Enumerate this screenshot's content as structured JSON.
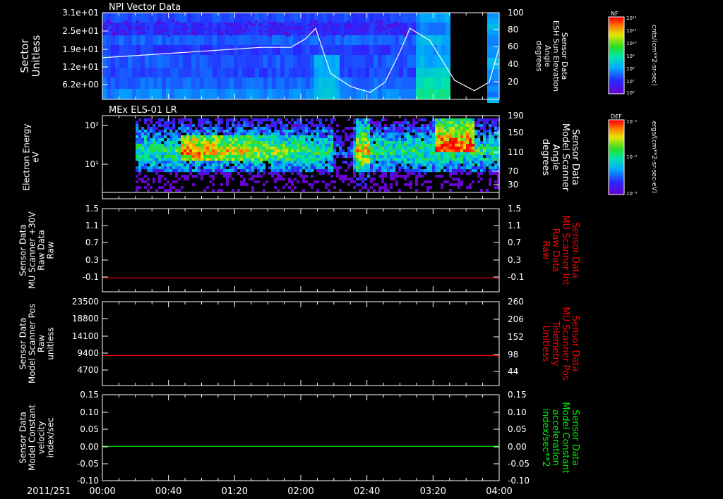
{
  "date_label": "2011/251",
  "time_ticks": [
    "00:00",
    "00:40",
    "01:20",
    "02:00",
    "02:40",
    "03:20",
    "04:00"
  ],
  "colors": {
    "red": "#ff0000",
    "green": "#00ee00",
    "white": "#ffffff"
  },
  "chart_data": [
    {
      "type": "heatmap",
      "title": "NPI Vector Data",
      "left_axis": {
        "label_lines": [
          "Sector",
          "Unitless"
        ],
        "ticks": [
          "3.1e+01",
          "2.5e+01",
          "1.9e+01",
          "1.2e+01",
          "6.2e+00"
        ]
      },
      "right_axis": {
        "label_lines": [
          "Sensor Data",
          "ESH Sun Elevation",
          "Angle",
          "degrees"
        ],
        "range": [
          0,
          100
        ],
        "ticks": [
          "100",
          "80",
          "60",
          "40",
          "20"
        ]
      },
      "colorbar": {
        "label": "NF",
        "unit": "cnts/(cm**2-sr-sec)",
        "ticks": [
          "10¹²",
          "10¹¹",
          "10¹⁰",
          "10⁹",
          "10⁸",
          "10⁷",
          "10⁶"
        ]
      },
      "overlay_line": {
        "x_hours": [
          0,
          1.6,
          1.9,
          2.05,
          2.15,
          2.3,
          2.5,
          2.7,
          2.85,
          3.0,
          3.1,
          3.3,
          3.55,
          3.75,
          3.9,
          4.0
        ],
        "y": [
          48,
          60,
          60,
          70,
          82,
          30,
          15,
          8,
          20,
          55,
          82,
          68,
          22,
          10,
          20,
          60
        ]
      }
    },
    {
      "type": "heatmap",
      "title": "MEx ELS-01 LR",
      "left_axis": {
        "label_lines": [
          "Electron Energy",
          "eV"
        ],
        "scale": "log",
        "ticks": [
          "10²",
          "10¹"
        ]
      },
      "right_axis": {
        "label_lines": [
          "Sensor Data",
          "Model Scanner",
          "Angle",
          "degrees"
        ],
        "range": [
          10,
          190
        ],
        "ticks": [
          "190",
          "150",
          "110",
          "70",
          "30"
        ]
      },
      "colorbar": {
        "label": "DEF",
        "unit": "ergs/(cm**2-sr-sec-eV)",
        "ticks": [
          "10⁻¹",
          "10⁻²",
          "10⁻³"
        ]
      },
      "overlay_line": {
        "x_hours": [
          0,
          4.0
        ],
        "y": [
          10,
          10
        ]
      }
    },
    {
      "type": "line",
      "left_axis": {
        "label_lines": [
          "Sensor Data",
          "MU Scanner +30V",
          "Raw Data",
          "Raw"
        ],
        "ticks": [
          "1.5",
          "1.1",
          "0.7",
          "0.3",
          "-0.1"
        ],
        "range": [
          -0.3,
          1.5
        ]
      },
      "right_axis": {
        "label_lines": [
          "Sensor Data",
          "MU Scanner Int",
          "Raw Data",
          "Raw"
        ],
        "ticks": [
          "1.5",
          "1.1",
          "0.7",
          "0.3",
          "-0.1"
        ],
        "color": "#ff0000"
      },
      "series": [
        {
          "color": "#ff0000",
          "x_hours": [
            0,
            4.0
          ],
          "values": [
            0.0,
            0.0
          ]
        }
      ]
    },
    {
      "type": "line",
      "left_axis": {
        "label_lines": [
          "Sensor Data",
          "Model Scanner Pos",
          "Raw",
          "unitless"
        ],
        "ticks": [
          "23500",
          "18800",
          "14100",
          "9400",
          "4700"
        ],
        "range": [
          0,
          23500
        ]
      },
      "right_axis": {
        "label_lines": [
          "Sensor Data",
          "MU Scanner Pos",
          "Telemetry",
          "Unitless"
        ],
        "ticks": [
          "260",
          "206",
          "152",
          "98",
          "44"
        ],
        "color": "#ff0000"
      },
      "series": [
        {
          "color": "#ff0000",
          "x_hours": [
            0,
            4.0
          ],
          "values": [
            8400,
            8400
          ]
        }
      ]
    },
    {
      "type": "line",
      "left_axis": {
        "label_lines": [
          "Sensor Data",
          "Model Constant",
          "velocity",
          "index/sec"
        ],
        "ticks": [
          "0.15",
          "0.10",
          "0.05",
          "0.00",
          "-0.05",
          "-0.10"
        ],
        "range": [
          -0.1,
          0.15
        ]
      },
      "right_axis": {
        "label_lines": [
          "Sensor Data",
          "Model Constant",
          "acceleration",
          "index/sec**2"
        ],
        "ticks": [
          "0.15",
          "0.10",
          "0.05",
          "0.00",
          "-0.05",
          "-0.10"
        ],
        "color": "#00ee00"
      },
      "series": [
        {
          "color": "#00ee00",
          "x_hours": [
            0,
            4.0
          ],
          "values": [
            0.0,
            0.0
          ]
        }
      ]
    }
  ]
}
